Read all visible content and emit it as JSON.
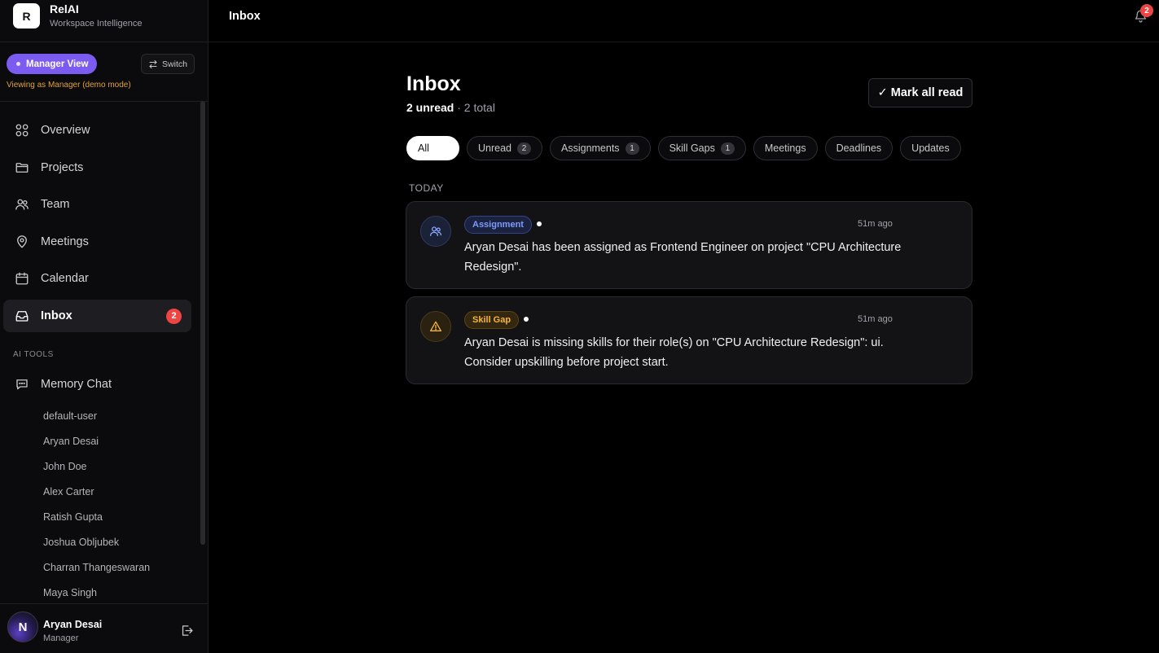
{
  "brand": {
    "logo_letter": "R",
    "name": "RelAI",
    "subtitle": "Workspace Intelligence"
  },
  "role": {
    "current": "Manager View",
    "switch_label": "Switch",
    "note": "Viewing as Manager (demo mode)"
  },
  "nav": {
    "items": [
      {
        "label": "Overview",
        "icon": "grid-icon"
      },
      {
        "label": "Projects",
        "icon": "folder-icon"
      },
      {
        "label": "Team",
        "icon": "users-icon"
      },
      {
        "label": "Meetings",
        "icon": "map-pin-icon"
      },
      {
        "label": "Calendar",
        "icon": "calendar-icon"
      },
      {
        "label": "Inbox",
        "icon": "inbox-icon",
        "badge": "2",
        "active": true
      }
    ],
    "section_ai": "AI TOOLS",
    "memory_chat": "Memory Chat",
    "users": [
      "default-user",
      "Aryan Desai",
      "John Doe",
      "Alex Carter",
      "Ratish Gupta",
      "Joshua Obljubek",
      "Charran Thangeswaran",
      "Maya Singh"
    ]
  },
  "current_user": {
    "avatar_letter": "N",
    "name": "Aryan Desai",
    "role": "Manager"
  },
  "topbar": {
    "title": "Inbox",
    "notification_count": "2"
  },
  "inbox": {
    "title": "Inbox",
    "unread_label": "2 unread",
    "total_label": "· 2 total",
    "mark_all_label": "Mark all read",
    "mark_all_icon": "✓",
    "tabs": [
      {
        "label": "All",
        "count": null,
        "active": true
      },
      {
        "label": "Unread",
        "count": "2"
      },
      {
        "label": "Assignments",
        "count": "1"
      },
      {
        "label": "Skill Gaps",
        "count": "1"
      },
      {
        "label": "Meetings",
        "count": null
      },
      {
        "label": "Deadlines",
        "count": null
      },
      {
        "label": "Updates",
        "count": null
      }
    ],
    "group_label": "TODAY",
    "notifications": [
      {
        "tag": "Assignment",
        "icon": "users-icon",
        "time": "51m ago",
        "text": "Aryan Desai has been assigned as Frontend Engineer on project \"CPU Architecture Redesign\".",
        "tag_color": "#6d8cff",
        "unread": true
      },
      {
        "tag": "Skill Gap",
        "icon": "warning-icon",
        "time": "51m ago",
        "text": "Aryan Desai is missing skills for their role(s) on \"CPU Architecture Redesign\": ui. Consider upskilling before project start.",
        "tag_color": "#f5b43c",
        "unread": true
      }
    ]
  },
  "colors": {
    "accent": "#7c5cf0",
    "badge": "#ef4444",
    "background": "#000000",
    "sidebar": "#0b0b0d",
    "card": "#131315"
  }
}
